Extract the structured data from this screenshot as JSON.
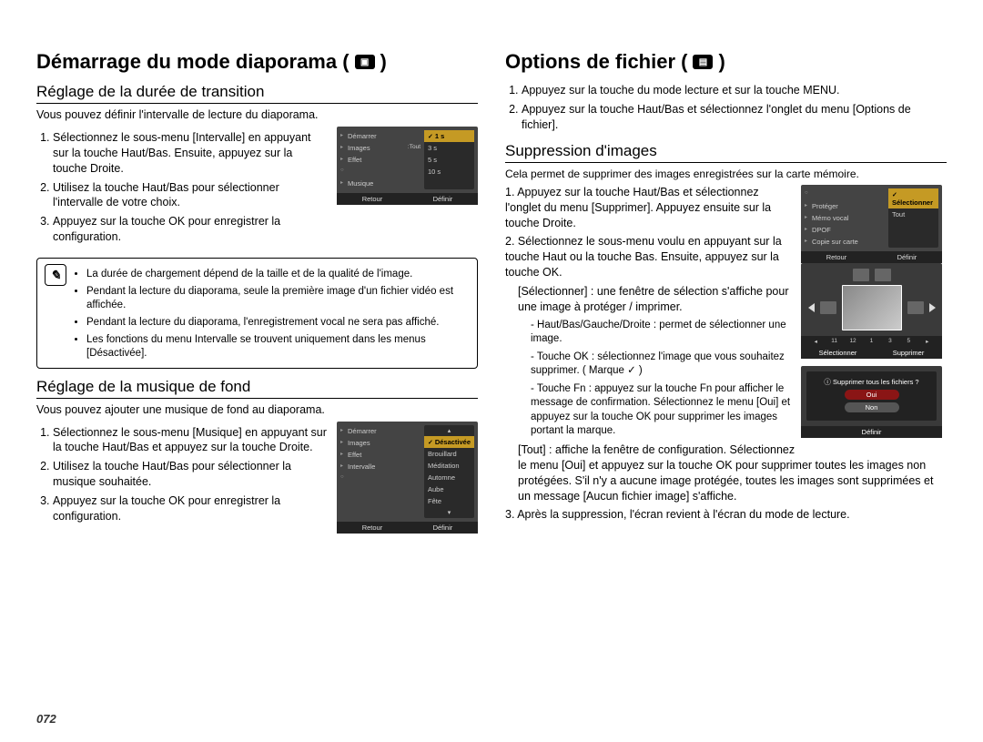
{
  "page_number": "072",
  "left": {
    "heading": "Démarrage du mode diaporama (",
    "heading_icon": "slideshow-icon",
    "section1": {
      "title": "Réglage de la durée de transition",
      "intro": "Vous pouvez définir l'intervalle de lecture du diaporama.",
      "steps": [
        "Sélectionnez le sous-menu [Intervalle] en appuyant sur la touche Haut/Bas. Ensuite, appuyez sur la touche Droite.",
        "Utilisez la touche Haut/Bas pour sélectionner l'intervalle de votre choix.",
        "Appuyez sur la touche OK pour enregistrer la configuration."
      ],
      "lcd": {
        "left": [
          "Démarrer",
          "Images",
          "Effet",
          "",
          "Musique"
        ],
        "tag": ":Tout",
        "right": [
          "1 s",
          "3 s",
          "5 s",
          "10 s"
        ],
        "highlight": 0,
        "footer": [
          "Retour",
          "Définir"
        ]
      },
      "notes": [
        "La durée de chargement dépend de la taille et de la qualité de l'image.",
        "Pendant la lecture du diaporama, seule la première image d'un fichier vidéo est affichée.",
        "Pendant la lecture du diaporama, l'enregistrement vocal ne sera pas affiché.",
        "Les fonctions du menu Intervalle se trouvent uniquement dans les menus [Désactivée]."
      ]
    },
    "section2": {
      "title": "Réglage de la musique de fond",
      "intro": "Vous pouvez ajouter une musique de fond au diaporama.",
      "steps": [
        "Sélectionnez le sous-menu [Musique] en appuyant sur la touche Haut/Bas et appuyez sur la touche Droite.",
        "Utilisez la touche Haut/Bas pour sélectionner la musique souhaitée.",
        "Appuyez sur la touche OK pour enregistrer la configuration."
      ],
      "lcd": {
        "left": [
          "Démarrer",
          "Images",
          "Effet",
          "Intervalle",
          ""
        ],
        "right": [
          "Désactivée",
          "Brouillard",
          "Méditation",
          "Automne",
          "Aube",
          "Fête"
        ],
        "highlight": 0,
        "footer": [
          "Retour",
          "Définir"
        ]
      }
    }
  },
  "right": {
    "heading": "Options de ﬁchier (",
    "heading_icon": "file-options-icon",
    "intro_steps": [
      "Appuyez sur la touche du mode lecture et sur la touche MENU.",
      "Appuyez sur la touche Haut/Bas et sélectionnez l'onglet du menu [Options de fichier]."
    ],
    "section1": {
      "title": "Suppression d'images",
      "intro": "Cela permet de supprimer des images enregistrées sur la carte mémoire.",
      "steps_main": [
        "Appuyez sur la touche Haut/Bas et sélectionnez l'onglet du menu [Supprimer]. Appuyez ensuite sur la touche Droite.",
        "Sélectionnez le sous-menu voulu en appuyant sur la touche Haut ou la touche Bas. Ensuite, appuyez sur la touche OK."
      ],
      "select_label": "[Sélectionner] : une fenêtre de sélection s'affiche pour une image à protéger / imprimer.",
      "sub_points": [
        "- Haut/Bas/Gauche/Droite : permet de sélectionner une image.",
        "- Touche OK : sélectionnez l'image que vous souhaitez supprimer. ( Marque ✓ )",
        "- Touche Fn : appuyez sur la touche Fn pour afficher le message de confirmation. Sélectionnez le menu [Oui] et appuyez sur la touche OK pour supprimer les images portant la marque."
      ],
      "tout_label": "[Tout] : affiche la fenêtre de configuration. Sélectionnez le menu [Oui] et appuyez sur la touche OK pour supprimer toutes les images non protégées. S'il n'y a aucune image protégée, toutes les images sont supprimées et un message [Aucun fichier image] s'affiche.",
      "step3": "Après la suppression, l'écran revient à l'écran du mode de lecture.",
      "lcd1": {
        "left": [
          "",
          "Protéger",
          "Mémo vocal",
          "DPOF",
          "Copie sur carte"
        ],
        "right": [
          "Sélectionner",
          "Tout"
        ],
        "highlight": 0,
        "footer": [
          "Retour",
          "Définir"
        ]
      },
      "thumbstrip": {
        "numbers": [
          "11",
          "12",
          "1",
          "3",
          "5"
        ],
        "footer": [
          "Sélectionner",
          "Supprimer"
        ]
      },
      "dialog": {
        "question": "Supprimer tous les fichiers ?",
        "oui": "Oui",
        "non": "Non",
        "footer": "Définir"
      }
    }
  }
}
